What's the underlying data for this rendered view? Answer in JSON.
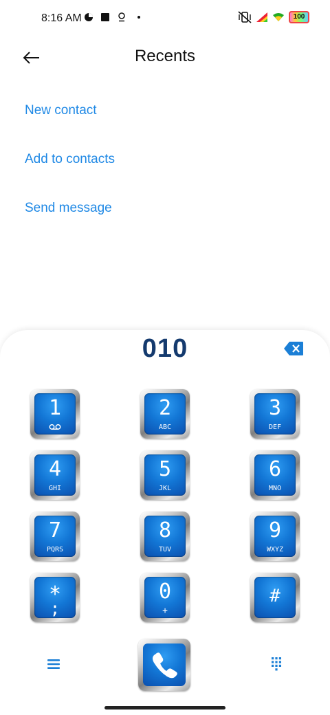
{
  "status_bar": {
    "time": "8:16 AM",
    "battery": "100"
  },
  "header": {
    "title": "Recents"
  },
  "actions": [
    "New contact",
    "Add to contacts",
    "Send message"
  ],
  "dialer": {
    "number": "010",
    "keys": [
      {
        "digit": "1",
        "letters": ""
      },
      {
        "digit": "2",
        "letters": "ABC"
      },
      {
        "digit": "3",
        "letters": "DEF"
      },
      {
        "digit": "4",
        "letters": "GHI"
      },
      {
        "digit": "5",
        "letters": "JKL"
      },
      {
        "digit": "6",
        "letters": "MNO"
      },
      {
        "digit": "7",
        "letters": "PQRS"
      },
      {
        "digit": "8",
        "letters": "TUV"
      },
      {
        "digit": "9",
        "letters": "WXYZ"
      },
      {
        "digit": "*",
        "letters": ";"
      },
      {
        "digit": "0",
        "letters": "+"
      },
      {
        "digit": "#",
        "letters": ""
      }
    ]
  },
  "colors": {
    "accent": "#1e88e5",
    "number": "#143a6e",
    "key_blue": "#1377d6"
  }
}
